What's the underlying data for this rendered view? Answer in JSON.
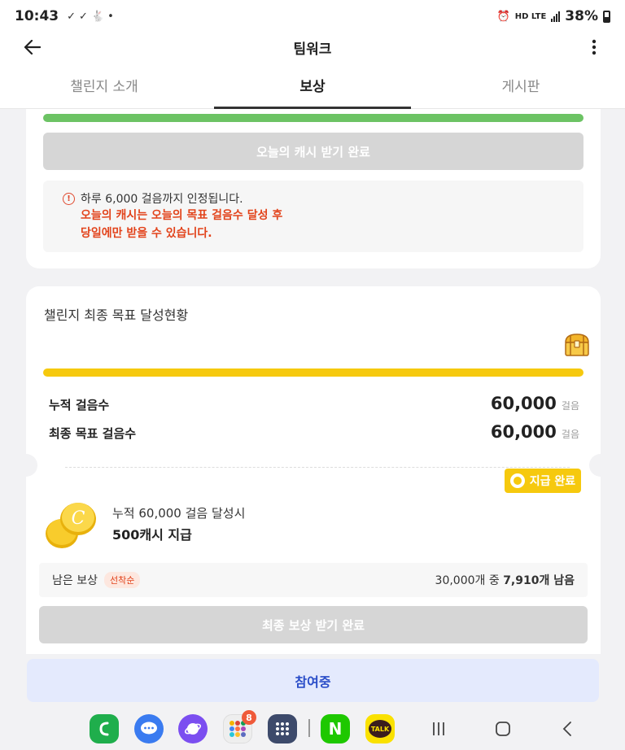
{
  "status_bar": {
    "time": "10:43",
    "notifications": [
      "✓",
      "✓",
      "🐇",
      "•"
    ],
    "network": "HD LTE",
    "battery": "38%"
  },
  "header": {
    "title": "팀워크"
  },
  "tabs": [
    {
      "label": "챌린지 소개",
      "active": false
    },
    {
      "label": "보상",
      "active": true
    },
    {
      "label": "게시판",
      "active": false
    }
  ],
  "daily": {
    "progress": 1.0,
    "button_label": "오늘의 캐시 받기 완료",
    "info_text": "하루 6,000 걸음까지 인정됩니다.",
    "warning_line1": "오늘의 캐시는 오늘의 목표 걸음수 달성 후",
    "warning_line2": "당일에만 받을 수 있습니다."
  },
  "final_goal": {
    "title": "챌린지 최종 목표 달성현황",
    "progress": 1.0,
    "cumulative_label": "누적 걸음수",
    "cumulative_value": "60,000",
    "goal_label": "최종 목표 걸음수",
    "goal_value": "60,000",
    "unit": "걸음",
    "paid_badge": "지급 완료",
    "reward_condition": "누적 60,000 걸음 달성시",
    "reward_amount": "500캐시 지급",
    "remain_label": "남은 보상",
    "first_come": "선착순",
    "remain_prefix": "30,000개 중 ",
    "remain_value": "7,910개 남음",
    "button_label": "최종 보상 받기 완료"
  },
  "join_button": "참여중",
  "dock": {
    "apps": [
      "phone-app",
      "messages-app",
      "internet-app",
      "folder-app",
      "apps-grid",
      "naver-app",
      "kakaotalk-app"
    ],
    "folder_badge": "8",
    "kakao_label": "TALK",
    "naver_label": "N"
  },
  "colors": {
    "daily_progress": "#6cc364",
    "goal_progress": "#f6c90e",
    "warning": "#e2431b",
    "join_text": "#2a4dc8"
  }
}
